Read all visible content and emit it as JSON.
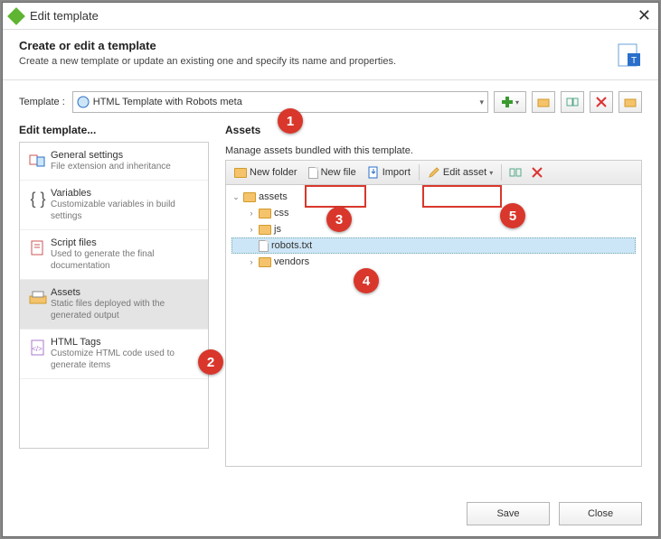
{
  "window": {
    "title": "Edit template"
  },
  "header": {
    "title": "Create or edit a template",
    "subtitle": "Create a new template or update an existing one and specify its name and properties."
  },
  "templateRow": {
    "label": "Template :",
    "selected": "HTML Template with Robots meta"
  },
  "sidebar": {
    "title": "Edit template...",
    "items": [
      {
        "title": "General settings",
        "sub": "File extension and inheritance"
      },
      {
        "title": "Variables",
        "sub": "Customizable variables in build settings"
      },
      {
        "title": "Script files",
        "sub": "Used to generate the final documentation"
      },
      {
        "title": "Assets",
        "sub": "Static files deployed with the generated output"
      },
      {
        "title": "HTML Tags",
        "sub": "Customize HTML code used to generate items"
      }
    ]
  },
  "main": {
    "title": "Assets",
    "instruction": "Manage assets bundled with this template.",
    "toolbar": {
      "newFolder": "New folder",
      "newFile": "New file",
      "import": "Import",
      "editAsset": "Edit asset"
    },
    "tree": {
      "root": "assets",
      "children": [
        {
          "name": "css",
          "type": "folder"
        },
        {
          "name": "js",
          "type": "folder"
        },
        {
          "name": "robots.txt",
          "type": "file",
          "selected": true
        },
        {
          "name": "vendors",
          "type": "folder"
        }
      ]
    }
  },
  "footer": {
    "save": "Save",
    "close": "Close"
  },
  "callouts": [
    "1",
    "2",
    "3",
    "4",
    "5"
  ]
}
